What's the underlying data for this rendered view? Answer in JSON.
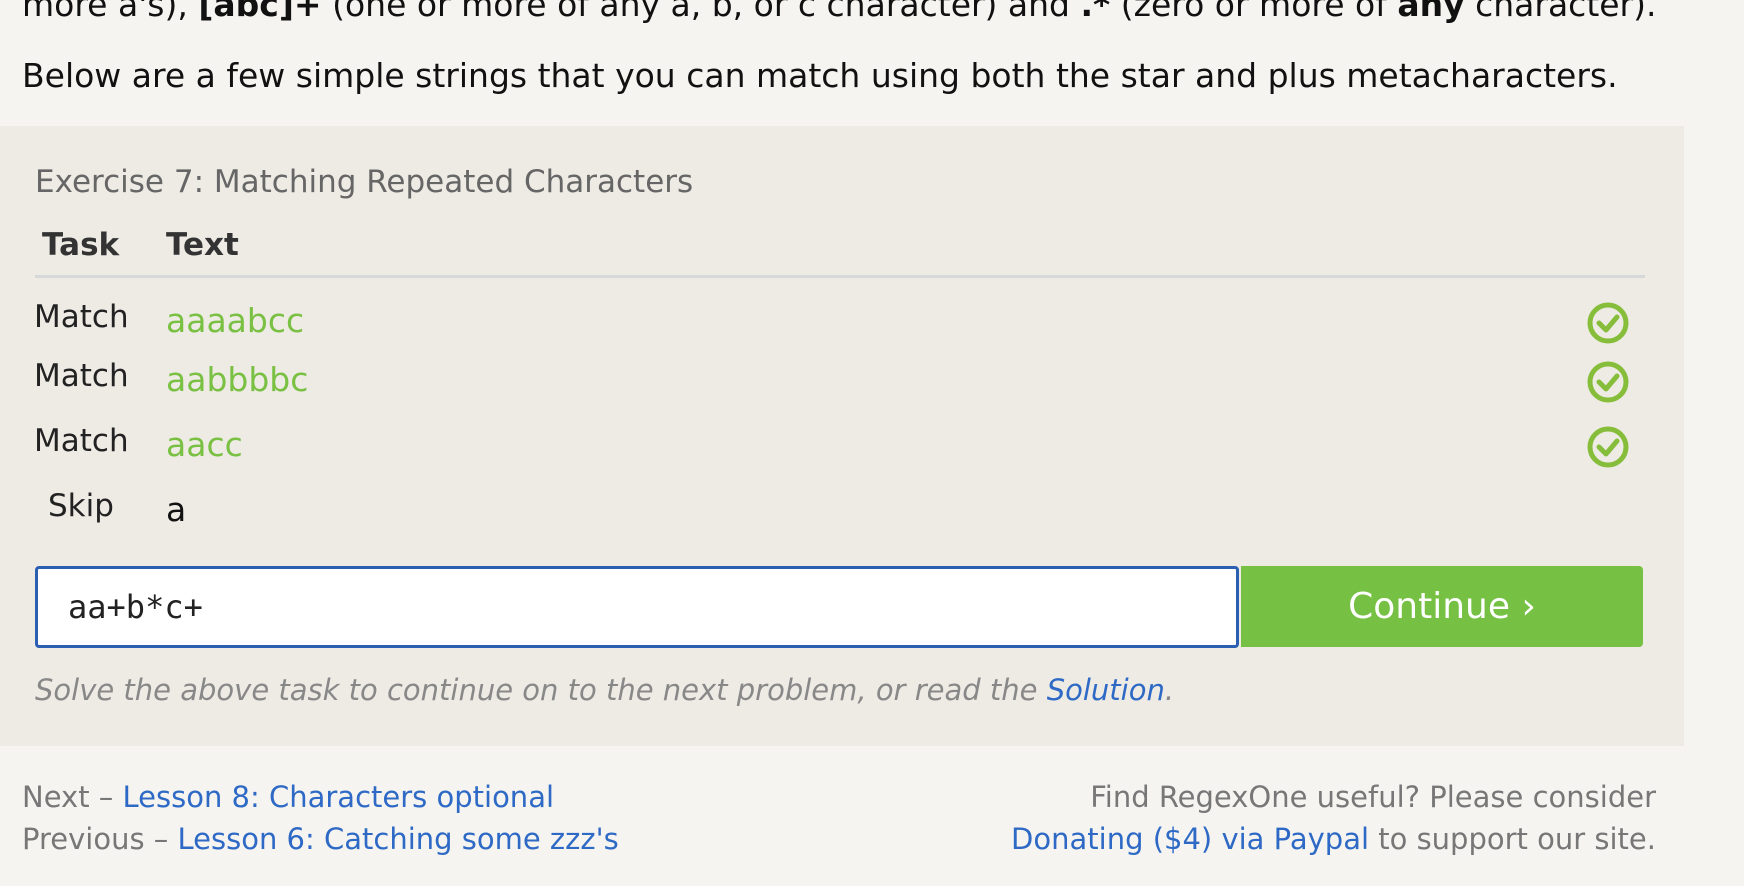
{
  "intro": {
    "top_parts": [
      "more a's), ",
      "[abc]+",
      " (one or more of any a, b, or c character) and ",
      ".*",
      " (zero or more of ",
      "any",
      " character)."
    ],
    "below": "Below are a few simple strings that you can match using both the star and plus metacharacters."
  },
  "exercise": {
    "title": "Exercise 7: Matching Repeated Characters",
    "headers": {
      "task": "Task",
      "text": "Text"
    },
    "rows": [
      {
        "task": "Match",
        "text": "aaaabcc",
        "status": "matched",
        "icon": "check-circle-icon"
      },
      {
        "task": "Match",
        "text": "aabbbbc",
        "status": "matched",
        "icon": "check-circle-icon"
      },
      {
        "task": "Match",
        "text": "aacc",
        "status": "matched",
        "icon": "check-circle-icon"
      },
      {
        "task": "Skip",
        "text": "a",
        "status": "skipped"
      }
    ],
    "input_value": "aa+b*c+",
    "continue_label": "Continue ›",
    "hint_prefix": "Solve the above task to continue on to the next problem, or read the ",
    "hint_link": "Solution",
    "hint_suffix": "."
  },
  "footer": {
    "next_prefix": "Next – ",
    "next_link": "Lesson 8: Characters optional",
    "prev_prefix": "Previous – ",
    "prev_link": "Lesson 6: Catching some zzz's",
    "donate_line1": "Find RegexOne useful? Please consider",
    "donate_link": "Donating ($4) via Paypal",
    "donate_suffix": " to support our site."
  },
  "colors": {
    "accent_green": "#76c043",
    "match_text": "#79c043",
    "link_blue": "#2e6ac5",
    "input_border": "#2b5fb2"
  }
}
